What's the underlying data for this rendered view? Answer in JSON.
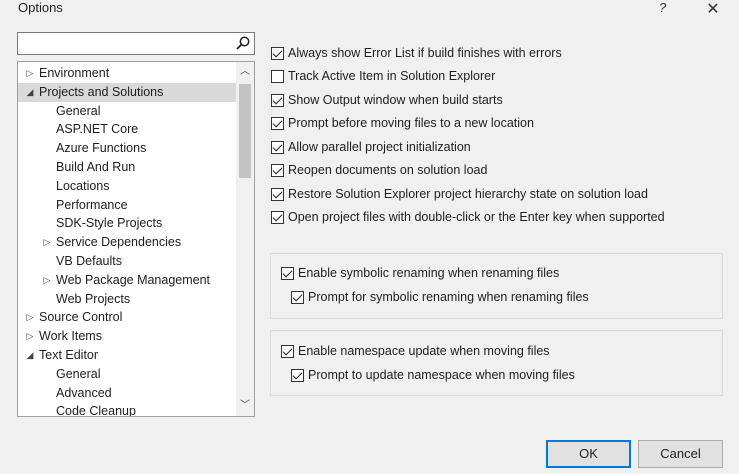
{
  "window": {
    "title": "Options",
    "help_label": "?",
    "close_label": "✕"
  },
  "search": {
    "value": "",
    "placeholder": ""
  },
  "tree": [
    {
      "label": "Environment",
      "level": 0,
      "arrow": "▷"
    },
    {
      "label": "Projects and Solutions",
      "level": 0,
      "arrow": "◢",
      "selected": true
    },
    {
      "label": "General",
      "level": 2,
      "arrow": ""
    },
    {
      "label": "ASP.NET Core",
      "level": 2,
      "arrow": ""
    },
    {
      "label": "Azure Functions",
      "level": 2,
      "arrow": ""
    },
    {
      "label": "Build And Run",
      "level": 2,
      "arrow": ""
    },
    {
      "label": "Locations",
      "level": 2,
      "arrow": ""
    },
    {
      "label": "Performance",
      "level": 2,
      "arrow": ""
    },
    {
      "label": "SDK-Style Projects",
      "level": 2,
      "arrow": ""
    },
    {
      "label": "Service Dependencies",
      "level": 1,
      "arrow": "▷"
    },
    {
      "label": "VB Defaults",
      "level": 2,
      "arrow": ""
    },
    {
      "label": "Web Package Management",
      "level": 1,
      "arrow": "▷"
    },
    {
      "label": "Web Projects",
      "level": 2,
      "arrow": ""
    },
    {
      "label": "Source Control",
      "level": 0,
      "arrow": "▷"
    },
    {
      "label": "Work Items",
      "level": 0,
      "arrow": "▷"
    },
    {
      "label": "Text Editor",
      "level": 0,
      "arrow": "◢"
    },
    {
      "label": "General",
      "level": 2,
      "arrow": ""
    },
    {
      "label": "Advanced",
      "level": 2,
      "arrow": ""
    },
    {
      "label": "Code Cleanup",
      "level": 2,
      "arrow": ""
    }
  ],
  "options": {
    "always_show_error_list": {
      "label": "Always show Error List if build finishes with errors",
      "checked": true
    },
    "track_active_item": {
      "label": "Track Active Item in Solution Explorer",
      "checked": false
    },
    "show_output_window": {
      "label": "Show Output window when build starts",
      "checked": true
    },
    "prompt_before_moving": {
      "label": "Prompt before moving files to a new location",
      "checked": true
    },
    "allow_parallel_init": {
      "label": "Allow parallel project initialization",
      "checked": true
    },
    "reopen_documents": {
      "label": "Reopen documents on solution load",
      "checked": true
    },
    "restore_hierarchy": {
      "label": "Restore Solution Explorer project hierarchy state on solution load",
      "checked": true
    },
    "open_project_files": {
      "label": "Open project files with double-click or the Enter key when supported",
      "checked": true
    },
    "enable_symbolic_renaming": {
      "label": "Enable symbolic renaming when renaming files",
      "checked": true
    },
    "prompt_symbolic_renaming": {
      "label": "Prompt for symbolic renaming when renaming files",
      "checked": true
    },
    "enable_namespace_update": {
      "label": "Enable namespace update when moving files",
      "checked": true
    },
    "prompt_namespace_update": {
      "label": "Prompt to update namespace when moving files",
      "checked": true
    }
  },
  "buttons": {
    "ok": "OK",
    "cancel": "Cancel"
  },
  "colors": {
    "accent": "#0078d7",
    "selected_row": "#d9d9d9",
    "background": "#f0f0f0"
  }
}
